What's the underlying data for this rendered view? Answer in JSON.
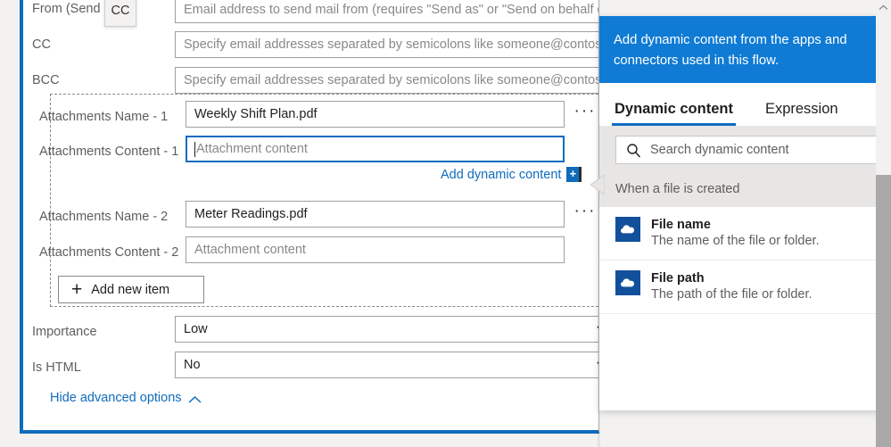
{
  "form": {
    "fields": [
      {
        "label": "From (Send as)",
        "placeholder": "Email address to send mail from (requires \"Send as\" or \"Send on behalf of\""
      },
      {
        "label": "CC",
        "placeholder": "Specify email addresses separated by semicolons like someone@contoso.com"
      },
      {
        "label": "BCC",
        "placeholder": "Specify email addresses separated by semicolons like someone@contoso.com"
      }
    ],
    "attachments": [
      {
        "name_label": "Attachments Name - 1",
        "name_value": "Weekly Shift Plan.pdf",
        "content_label": "Attachments Content - 1",
        "content_placeholder": "Attachment content",
        "content_focused": true,
        "more_menu": "···"
      },
      {
        "name_label": "Attachments Name - 2",
        "name_value": "Meter Readings.pdf",
        "content_label": "Attachments Content - 2",
        "content_placeholder": "Attachment content",
        "content_focused": false,
        "more_menu": "···"
      }
    ],
    "add_dynamic_content_label": "Add dynamic content",
    "add_dynamic_content_plus": "+",
    "add_new_item_label": "Add new item",
    "add_new_item_plus": "+",
    "importance": {
      "label": "Importance",
      "value": "Low"
    },
    "is_html": {
      "label": "Is HTML",
      "value": "No"
    },
    "hide_advanced_label": "Hide advanced options"
  },
  "tooltip": {
    "text": "CC"
  },
  "dynamic_panel": {
    "header": "Add dynamic content from the apps and connectors used in this flow.",
    "tabs": [
      {
        "label": "Dynamic content",
        "active": true
      },
      {
        "label": "Expression",
        "active": false
      }
    ],
    "search_placeholder": "Search dynamic content",
    "group_title": "When a file is created",
    "items": [
      {
        "title": "File name",
        "description": "The name of the file or folder.",
        "icon": "onedrive-cloud-icon"
      },
      {
        "title": "File path",
        "description": "The path of the file or folder.",
        "icon": "onedrive-cloud-icon"
      }
    ]
  },
  "colors": {
    "accent_blue": "#0f6cbd",
    "header_blue": "#0f7bd4",
    "icon_blue": "#12509b",
    "label_gray": "#605e5c",
    "border_gray": "#a19f9d"
  }
}
